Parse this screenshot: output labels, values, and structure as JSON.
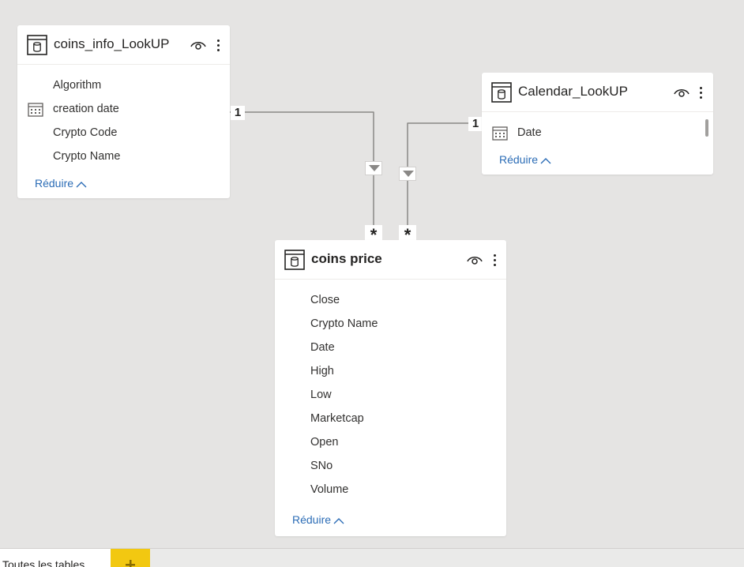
{
  "tables": {
    "coins_info": {
      "title": "coins_info_LookUP",
      "fields": [
        {
          "name": "Algorithm",
          "icon": ""
        },
        {
          "name": "creation date",
          "icon": "calendar-icon"
        },
        {
          "name": "Crypto Code",
          "icon": ""
        },
        {
          "name": "Crypto Name",
          "icon": ""
        }
      ],
      "collapse_label": "Réduire"
    },
    "calendar": {
      "title": "Calendar_LookUP",
      "fields": [
        {
          "name": "Date",
          "icon": "calendar-icon"
        }
      ],
      "collapse_label": "Réduire"
    },
    "coins_price": {
      "title": "coins price",
      "fields": [
        {
          "name": "Close",
          "icon": ""
        },
        {
          "name": "Crypto Name",
          "icon": ""
        },
        {
          "name": "Date",
          "icon": ""
        },
        {
          "name": "High",
          "icon": ""
        },
        {
          "name": "Low",
          "icon": ""
        },
        {
          "name": "Marketcap",
          "icon": ""
        },
        {
          "name": "Open",
          "icon": ""
        },
        {
          "name": "SNo",
          "icon": ""
        },
        {
          "name": "Volume",
          "icon": ""
        }
      ],
      "collapse_label": "Réduire"
    }
  },
  "relationships": [
    {
      "from": "coins_info_LookUP",
      "to": "coins price",
      "one_label": "1",
      "many_label": "*"
    },
    {
      "from": "Calendar_LookUP",
      "to": "coins price",
      "one_label": "1",
      "many_label": "*"
    }
  ],
  "bottom_bar": {
    "tab_all_label": "Toutes les tables",
    "add_label": "+"
  },
  "colors": {
    "canvas": "#e5e4e3",
    "link": "#2b6cb6",
    "add_tab": "#f2c811",
    "relationship_line": "#8a8886"
  }
}
